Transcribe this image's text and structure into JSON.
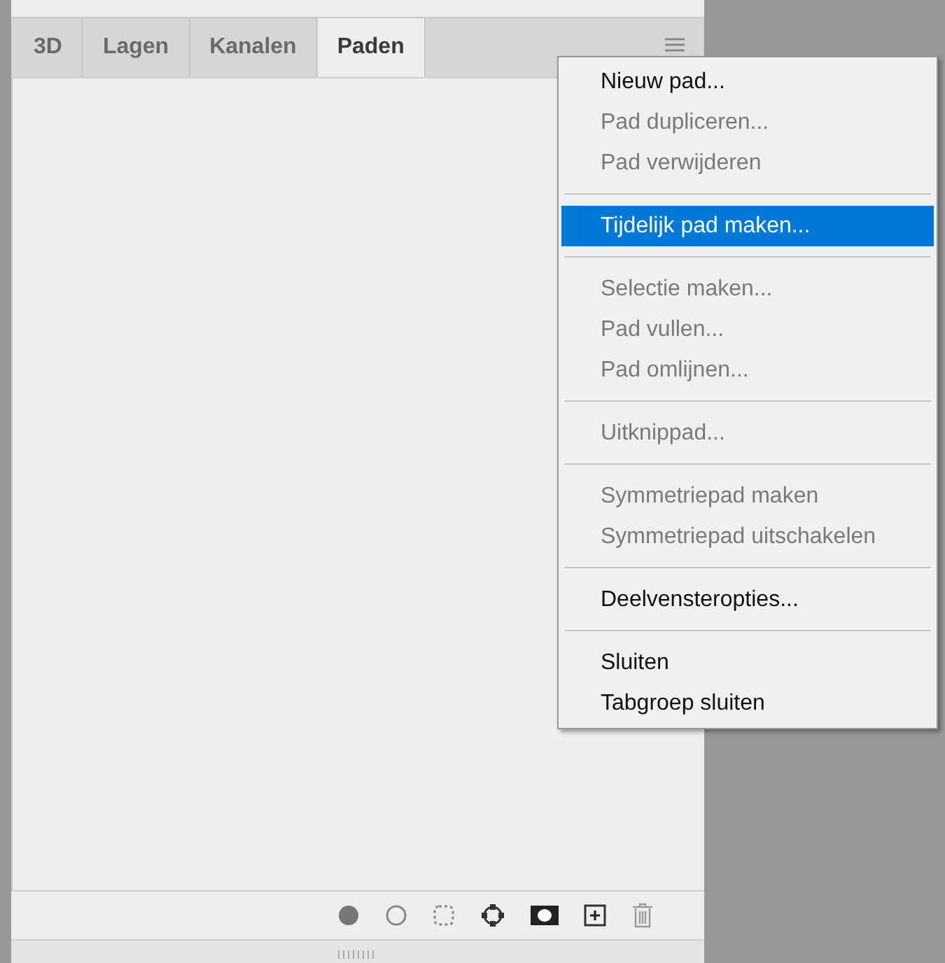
{
  "tabs": [
    {
      "label": "3D",
      "selected": false
    },
    {
      "label": "Lagen",
      "selected": false
    },
    {
      "label": "Kanalen",
      "selected": false
    },
    {
      "label": "Paden",
      "selected": true
    }
  ],
  "menu": {
    "items": [
      {
        "kind": "item",
        "label": "Nieuw pad...",
        "disabled": false,
        "selected": false
      },
      {
        "kind": "item",
        "label": "Pad dupliceren...",
        "disabled": true,
        "selected": false
      },
      {
        "kind": "item",
        "label": "Pad verwijderen",
        "disabled": true,
        "selected": false
      },
      {
        "kind": "separator"
      },
      {
        "kind": "item",
        "label": "Tijdelijk pad maken...",
        "disabled": false,
        "selected": true
      },
      {
        "kind": "separator"
      },
      {
        "kind": "item",
        "label": "Selectie maken...",
        "disabled": true,
        "selected": false
      },
      {
        "kind": "item",
        "label": "Pad vullen...",
        "disabled": true,
        "selected": false
      },
      {
        "kind": "item",
        "label": "Pad omlijnen...",
        "disabled": true,
        "selected": false
      },
      {
        "kind": "separator"
      },
      {
        "kind": "item",
        "label": "Uitknippad...",
        "disabled": true,
        "selected": false
      },
      {
        "kind": "separator"
      },
      {
        "kind": "item",
        "label": "Symmetriepad maken",
        "disabled": true,
        "selected": false
      },
      {
        "kind": "item",
        "label": "Symmetriepad uitschakelen",
        "disabled": true,
        "selected": false
      },
      {
        "kind": "separator"
      },
      {
        "kind": "item",
        "label": "Deelvensteropties...",
        "disabled": false,
        "selected": false
      },
      {
        "kind": "separator"
      },
      {
        "kind": "item",
        "label": "Sluiten",
        "disabled": false,
        "selected": false
      },
      {
        "kind": "item",
        "label": "Tabgroep sluiten",
        "disabled": false,
        "selected": false
      }
    ]
  }
}
